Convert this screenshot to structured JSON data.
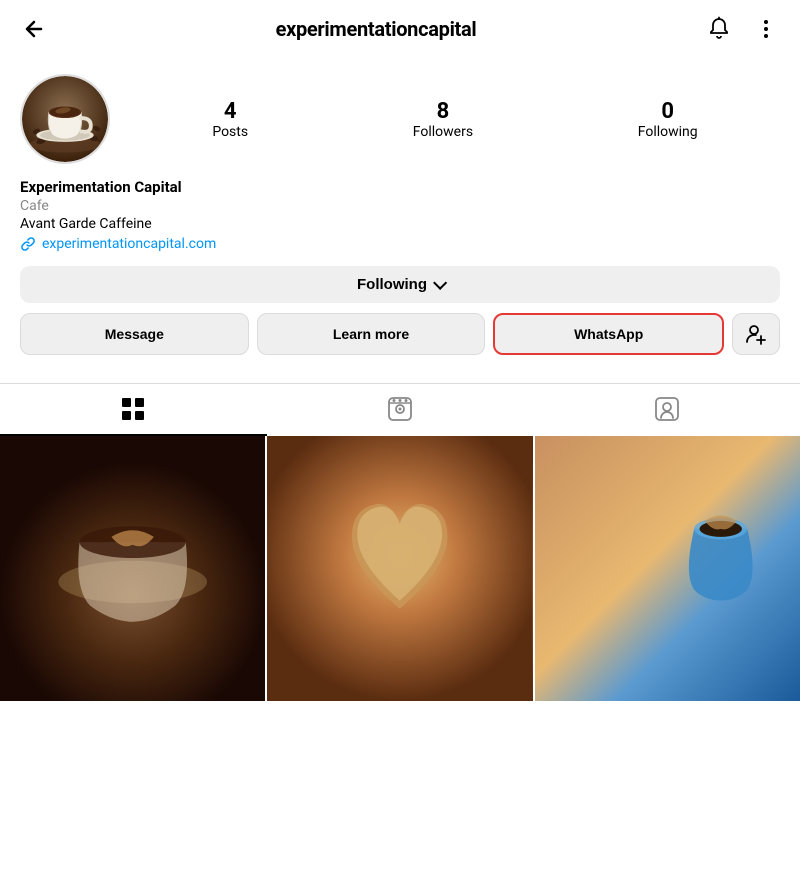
{
  "header": {
    "username": "experimentationcapital",
    "back_label": "←",
    "notification_icon": "bell",
    "more_icon": "three-dots"
  },
  "profile": {
    "name": "Experimentation Capital",
    "category": "Cafe",
    "bio": "Avant Garde Caffeine",
    "website_text": "experimentationcapital.com",
    "website_url": "https://experimentationcapital.com",
    "stats": {
      "posts_count": "4",
      "posts_label": "Posts",
      "followers_count": "8",
      "followers_label": "Followers",
      "following_count": "0",
      "following_label": "Following"
    }
  },
  "buttons": {
    "following_label": "Following",
    "message_label": "Message",
    "learn_more_label": "Learn more",
    "whatsapp_label": "WhatsApp",
    "add_friend_icon": "+👤"
  },
  "tabs": {
    "grid_icon": "grid",
    "reels_icon": "reels",
    "tagged_icon": "tagged"
  },
  "colors": {
    "accent": "#0095f6",
    "border": "#dbdbdb",
    "whatsapp_border": "#e53935",
    "button_bg": "#efefef"
  }
}
